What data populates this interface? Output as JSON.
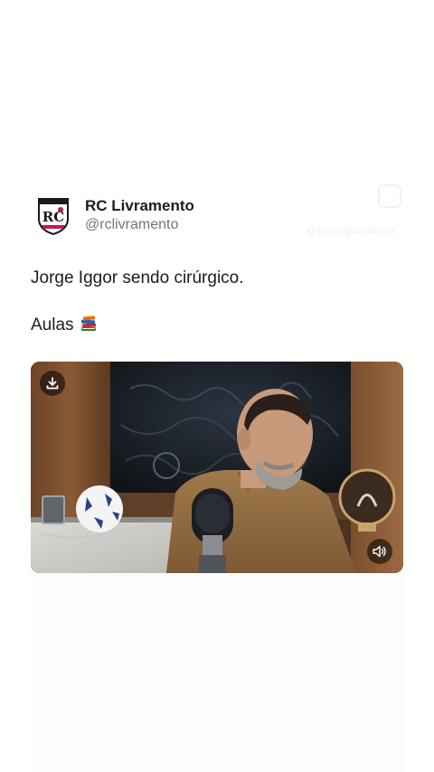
{
  "tweet": {
    "display_name": "RC Livramento",
    "handle": "@rclivramento",
    "text_line1": "Jorge Iggor sendo cirúrgico.",
    "text_line2": "Aulas",
    "emoji": "books-emoji",
    "avatar_initials": "RC"
  },
  "watermark": {
    "text": "@rodrigonovato"
  },
  "video": {
    "download_icon": "download-icon",
    "volume_icon": "volume-icon"
  },
  "colors": {
    "name": "#1c1c1c",
    "handle": "#70757a",
    "avatar_magenta": "#c2185b",
    "overlay_button": "rgba(0,0,0,0.55)"
  }
}
